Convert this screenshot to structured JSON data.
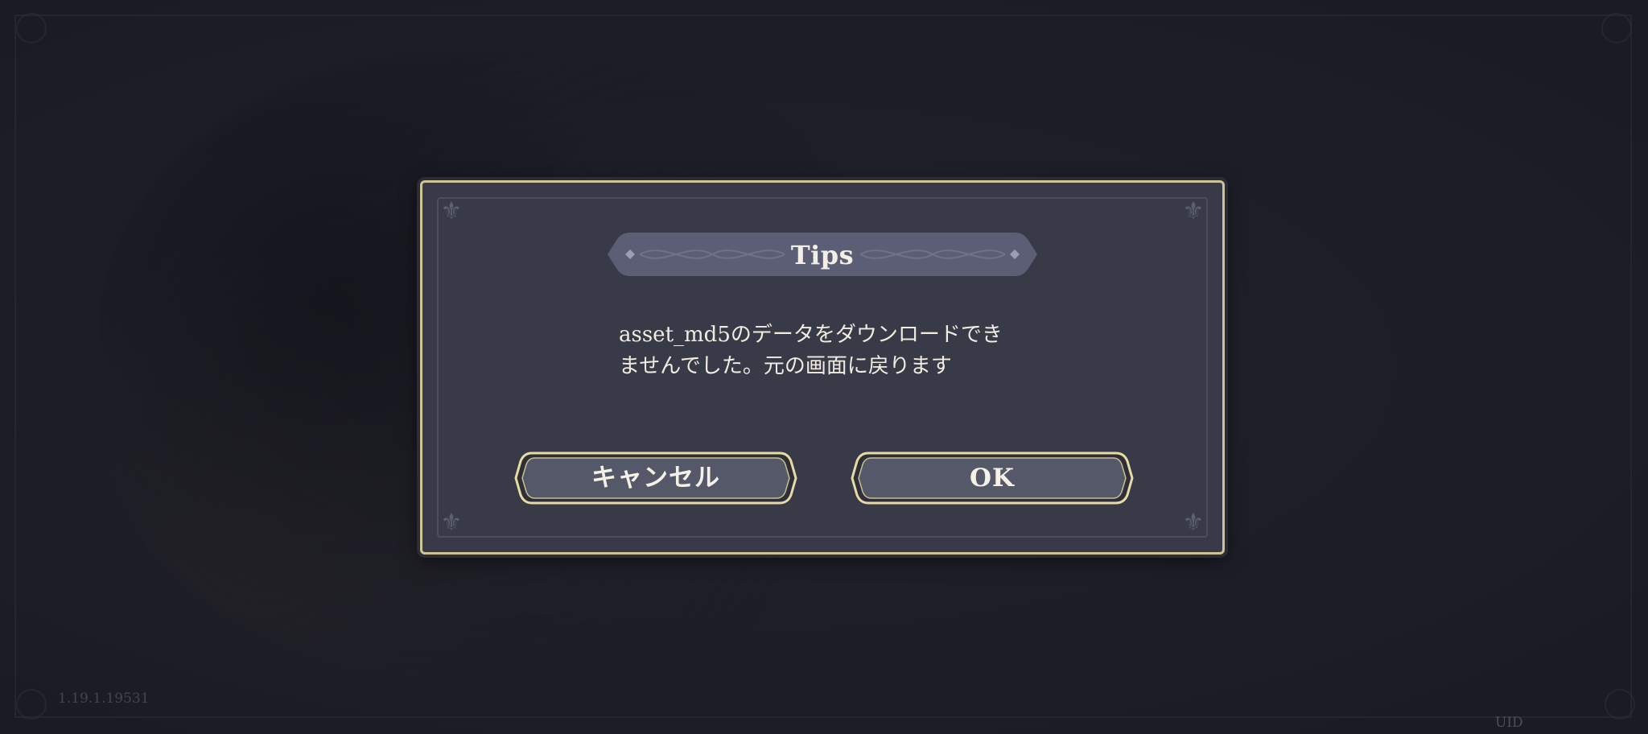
{
  "dialog": {
    "title": "Tips",
    "message_line1": "asset_md5のデータをダウンロードでき",
    "message_line2": "ませんでした。元の画面に戻ります",
    "cancel_label": "キャンセル",
    "ok_label": "OK"
  },
  "footer": {
    "version": "1.19.1.19531",
    "uid_label": "UID"
  },
  "icons": {
    "dialog_corners": "fleur-ornament-icon",
    "title_ornament": "filigree-ornament-icon"
  },
  "colors": {
    "background": "#23242f",
    "dialog_fill": "#383a47",
    "gold_border": "#cfc493",
    "title_band": "#5b5e74",
    "button_fill": "#555868",
    "text": "#f1ece0"
  }
}
